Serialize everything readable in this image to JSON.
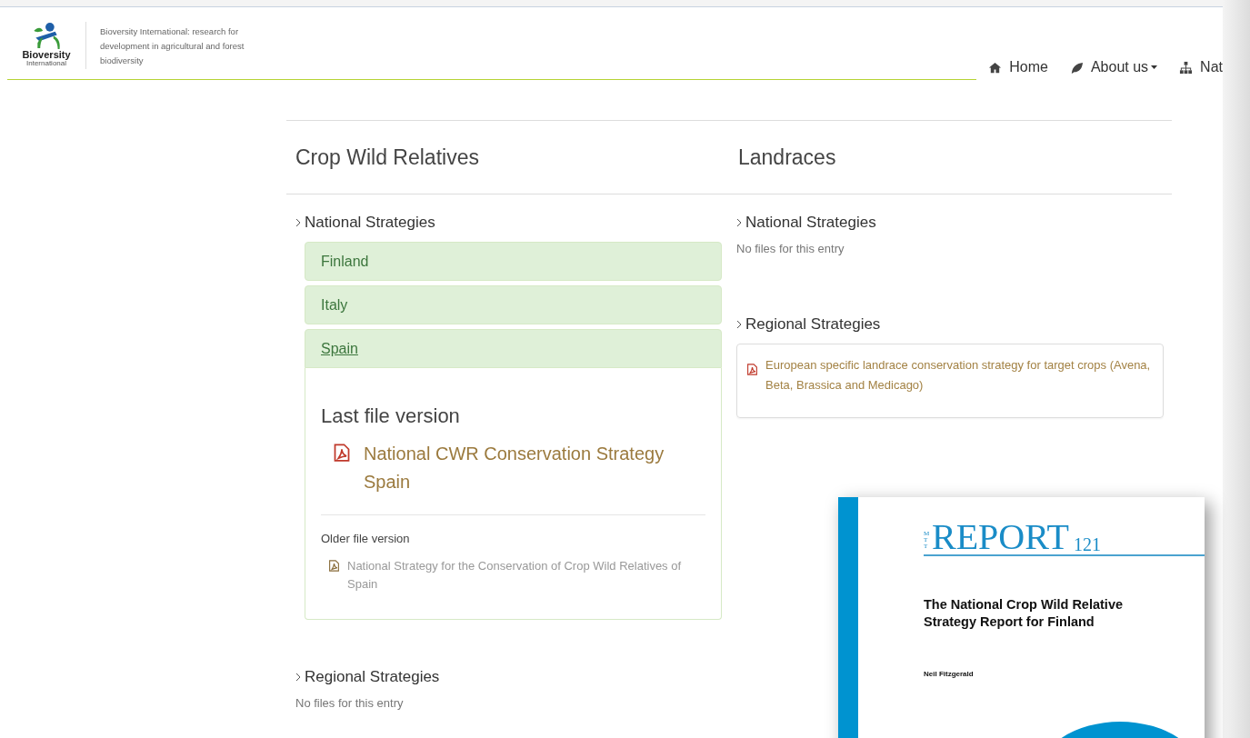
{
  "header": {
    "logo": {
      "name": "Bioversity",
      "subtitle": "International"
    },
    "tagline": "Bioversity International: research for development in agricultural and forest biodiversity",
    "nav": [
      {
        "kind": "home",
        "label": "Home",
        "dropdown": false
      },
      {
        "kind": "leaf",
        "label": "About us",
        "dropdown": true
      },
      {
        "kind": "sitemap",
        "label": "Nat",
        "dropdown": false
      }
    ]
  },
  "columns": [
    {
      "title": "Crop Wild Relatives",
      "groups": [
        {
          "title": "National Strategies",
          "entries": [
            {
              "label": "Finland",
              "expanded": false
            },
            {
              "label": "Italy",
              "expanded": false
            },
            {
              "label": "Spain",
              "expanded": true,
              "last_title": "Last file version",
              "last_file": "National CWR Conservation Strategy Spain",
              "older_title": "Older file version",
              "older_files": [
                "National Strategy for the Conservation of Crop Wild Relatives of Spain"
              ]
            }
          ]
        },
        {
          "title": "Regional Strategies",
          "empty_text": "No files for this entry"
        }
      ]
    },
    {
      "title": "Landraces",
      "groups": [
        {
          "title": "National Strategies",
          "empty_text": "No files for this entry"
        },
        {
          "title": "Regional Strategies",
          "files": [
            "European specific landrace conservation strategy for target crops (Avena, Beta, Brassica and Medicago)"
          ]
        }
      ]
    }
  ],
  "report_cover": {
    "series": "MTT",
    "word": "REPORT",
    "number": "121",
    "title": "The National Crop Wild Relative Strategy Report for Finland",
    "author": "Neil Fitzgerald"
  }
}
